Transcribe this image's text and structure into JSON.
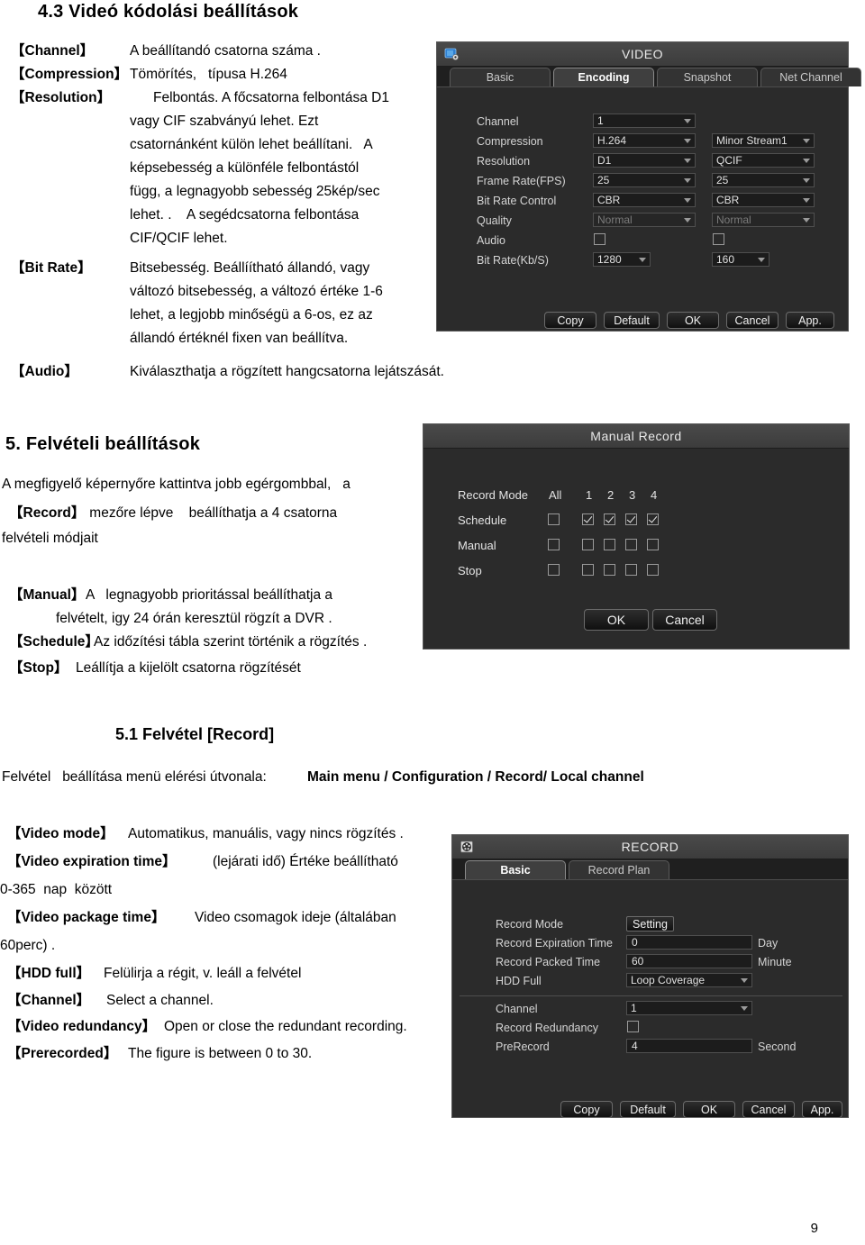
{
  "page": {
    "number": "9"
  },
  "section43": {
    "heading": "4.3 Videó kódolási beállítások",
    "terms": [
      {
        "term": "【Channel】",
        "text": "A beállítandó csatorna száma ."
      },
      {
        "term": "【Compression】",
        "text": "Tömörítés,   típusa H.264"
      },
      {
        "term": "【Resolution】",
        "text": "Felbontás. A főcsatorna felbontása D1"
      },
      {
        "term": "【Bit Rate】",
        "text": "Bitsebesség. Beállíítható állandó, vagy"
      },
      {
        "term": "【Audio】",
        "text": "Kiválaszthatja a rögzített hangcsatorna lejátszását."
      }
    ],
    "resolution_lines": [
      "vagy CIF szabványú lehet. Ezt",
      "csatornánként külön lehet beállítani.   A",
      "képsebesség a különféle felbontástól",
      "függ, a legnagyobb sebesség 25kép/sec",
      "lehet. .    A segédcsatorna felbontása",
      "CIF/QCIF lehet."
    ],
    "bitrate_lines": [
      "változó bitsebesség, a változó értéke 1-6",
      "lehet, a legjobb minőségü a 6-os, ez az",
      "állandó értéknél fixen van beállítva."
    ]
  },
  "video_dialog": {
    "icon": "video-camera-icon",
    "title": "VIDEO",
    "tabs": [
      {
        "label": "Basic",
        "active": false
      },
      {
        "label": "Encoding",
        "active": true
      },
      {
        "label": "Snapshot",
        "active": false
      },
      {
        "label": "Net Channel",
        "active": false
      }
    ],
    "rows": [
      {
        "label": "Channel",
        "main": "1",
        "sub": null
      },
      {
        "label": "Compression",
        "main": "H.264",
        "sub": "Minor Stream1"
      },
      {
        "label": "Resolution",
        "main": "D1",
        "sub": "QCIF"
      },
      {
        "label": "Frame Rate(FPS)",
        "main": "25",
        "sub": "25"
      },
      {
        "label": "Bit Rate Control",
        "main": "CBR",
        "sub": "CBR"
      },
      {
        "label": "Quality",
        "main": "Normal",
        "sub": "Normal",
        "disabled": true
      },
      {
        "label": "Audio",
        "main": null,
        "sub": null,
        "checkbox": true
      },
      {
        "label": "Bit Rate(Kb/S)",
        "main": "1280",
        "sub": "160"
      }
    ],
    "buttons": [
      "Copy",
      "Default",
      "OK",
      "Cancel",
      "App."
    ]
  },
  "section5": {
    "heading": "5.  Felvételi beállítások",
    "intro_line1": "A megfigyelő képernyőre kattintva jobb egérgombbal,   a",
    "intro_record_term": "【Record】",
    "intro_line2_rest": " mezőre lépve    beállíthatja a 4 csatorna",
    "intro_line3": "felvételi módjait",
    "terms": [
      {
        "term": "【Manual】",
        "text": "A   legnagyobb prioritással beállíthatja a"
      },
      {
        "term": "",
        "text": "felvételt, igy 24 órán keresztül rögzít a DVR ."
      },
      {
        "term": "【Schedule】",
        "text": "Az időzítési tábla szerint történik a rögzítés ."
      },
      {
        "term": "【Stop】",
        "text": "Leállítja a kijelölt csatorna rögzítését"
      }
    ]
  },
  "manual_record_dialog": {
    "title": "Manual Record",
    "mode_label": "Record Mode",
    "columns": [
      "All",
      "1",
      "2",
      "3",
      "4"
    ],
    "rows": [
      {
        "label": "Schedule",
        "checks": [
          false,
          true,
          true,
          true,
          true
        ]
      },
      {
        "label": "Manual",
        "checks": [
          false,
          false,
          false,
          false,
          false
        ]
      },
      {
        "label": "Stop",
        "checks": [
          false,
          false,
          false,
          false,
          false
        ]
      }
    ],
    "buttons": [
      "OK",
      "Cancel"
    ]
  },
  "section51": {
    "heading": "5.1 Felvétel [Record]",
    "path_prefix": "Felvétel   beállítása menü elérési útvonala:  ",
    "path_bold": "Main menu / Configuration / Record/ Local channel",
    "terms": [
      {
        "term": "【Video mode】",
        "text": "Automatikus, manuális, vagy nincs rögzítés ."
      },
      {
        "term": "【Video expiration time】",
        "text": "(lejárati idő) Értéke beállítható"
      },
      {
        "term": "",
        "text": "0-365  nap  között",
        "plain": true
      },
      {
        "term": "【Video package time】",
        "text": "Video csomagok ideje (általában"
      },
      {
        "term": "",
        "text": "60perc) .",
        "plain": true
      },
      {
        "term": "【HDD full】",
        "text": "Felülirja a régit, v. leáll a felvétel"
      },
      {
        "term": "【Channel】",
        "text": "Select a channel."
      },
      {
        "term": "【Video redundancy】",
        "text": "Open or close the redundant recording."
      },
      {
        "term": "【Prerecorded】",
        "text": "The figure is between 0 to 30."
      }
    ]
  },
  "record_dialog": {
    "icon": "film-reel-icon",
    "title": "RECORD",
    "tabs": [
      {
        "label": "Basic",
        "active": true
      },
      {
        "label": "Record Plan",
        "active": false
      }
    ],
    "rows": [
      {
        "label": "Record Mode",
        "type": "button",
        "value": "Setting",
        "unit": ""
      },
      {
        "label": "Record Expiration Time",
        "type": "field",
        "value": "0",
        "unit": "Day"
      },
      {
        "label": "Record Packed Time",
        "type": "field",
        "value": "60",
        "unit": "Minute"
      },
      {
        "label": "HDD Full",
        "type": "select",
        "value": "Loop Coverage",
        "unit": ""
      },
      {
        "label": "Channel",
        "type": "select",
        "value": "1",
        "unit": ""
      },
      {
        "label": "Record Redundancy",
        "type": "checkbox",
        "value": "",
        "unit": ""
      },
      {
        "label": "PreRecord",
        "type": "field",
        "value": "4",
        "unit": "Second"
      }
    ],
    "buttons": [
      "Copy",
      "Default",
      "OK",
      "Cancel",
      "App."
    ]
  }
}
